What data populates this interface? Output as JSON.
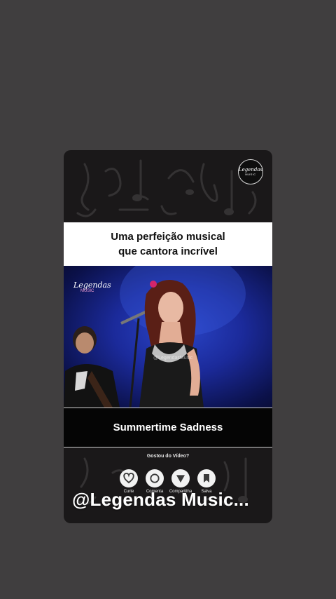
{
  "post": {
    "headline_line1": "Uma perfeição musical",
    "headline_line2": "que cantora incrível",
    "song_title": "Summertime Sadness",
    "prompt": "Gostou do Vídeo?",
    "handle": "@Legendas Music...",
    "badge_line1": "Legendas",
    "badge_line2": "MUSIC",
    "video_logo_line1": "Legendas",
    "video_logo_line2": "MUSIC",
    "video_watermark": "@LegendasMusic"
  },
  "actions": [
    {
      "label": "Curte",
      "icon": "heart-icon"
    },
    {
      "label": "Comenta",
      "icon": "comment-icon"
    },
    {
      "label": "Compartilha",
      "icon": "share-icon"
    },
    {
      "label": "Salva",
      "icon": "bookmark-icon"
    }
  ],
  "colors": {
    "background": "#403e3f",
    "card": "#1a1819",
    "stage_blue": "#1b2a9a",
    "white": "#ffffff"
  }
}
